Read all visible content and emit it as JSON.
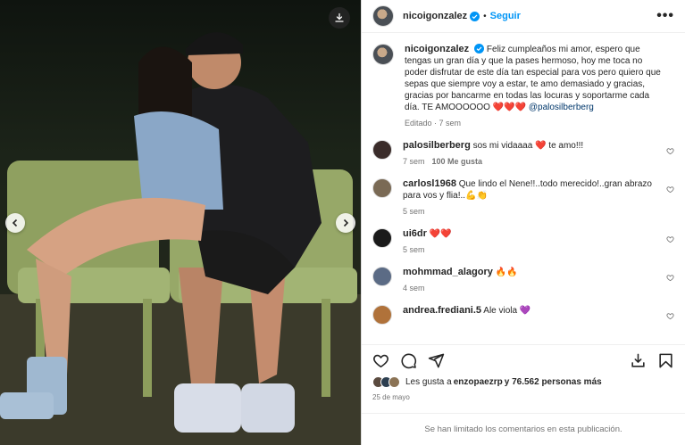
{
  "post": {
    "username": "nicoigonzalez",
    "follow_label": "Seguir",
    "more_label": "•••",
    "caption_text": "Feliz cumpleaños mi amor, espero que tengas un gran día y que la pases hermoso, hoy me toca no poder disfrutar de este día tan especial para vos pero quiero que sepas que siempre voy a estar, te amo demasiado y gracias, gracias por bancarme en todas las locuras y soportarme cada día. TE AMOOOOOO ❤️❤️❤️",
    "caption_mention": "@palosilberberg",
    "caption_meta": "Editado · 7 sem"
  },
  "comments": [
    {
      "user": "palosilberberg",
      "text": "sos mi vidaaaa ❤️ te amo!!!",
      "time": "7 sem",
      "likes": "100 Me gusta",
      "avatar_color": "#3a2c2a"
    },
    {
      "user": "carlosl1968",
      "text": "Que lindo el Nene!!..todo merecido!..gran abrazo para vos y flia!..💪👏",
      "time": "5 sem",
      "likes": "",
      "avatar_color": "#7a6a55"
    },
    {
      "user": "ui6dr",
      "text": "❤️❤️",
      "time": "5 sem",
      "likes": "",
      "avatar_color": "#1a1a1a"
    },
    {
      "user": "mohmmad_alagory",
      "text": "🔥🔥",
      "time": "4 sem",
      "likes": "",
      "avatar_color": "#5b6b85"
    },
    {
      "user": "andrea.frediani.5",
      "text": "Ale viola 💜",
      "time": "",
      "likes": "",
      "avatar_color": "#b0723a"
    }
  ],
  "likes": {
    "prefix": "Les gusta a ",
    "user": "enzopaezrp",
    "suffix": " y 76.562 personas más"
  },
  "date": "25 de mayo",
  "comments_limited": "Se han limitado los comentarios en esta publicación.",
  "icons": {
    "download": "download-icon",
    "prev": "chevron-left-icon",
    "next": "chevron-right-icon",
    "like": "heart-icon",
    "comment": "comment-icon",
    "share": "share-icon",
    "save": "bookmark-icon",
    "add_to_story": "download-tray-icon"
  },
  "colors": {
    "accent": "#0095f6",
    "verified": "#0095f6",
    "heart": "#ed4956"
  }
}
